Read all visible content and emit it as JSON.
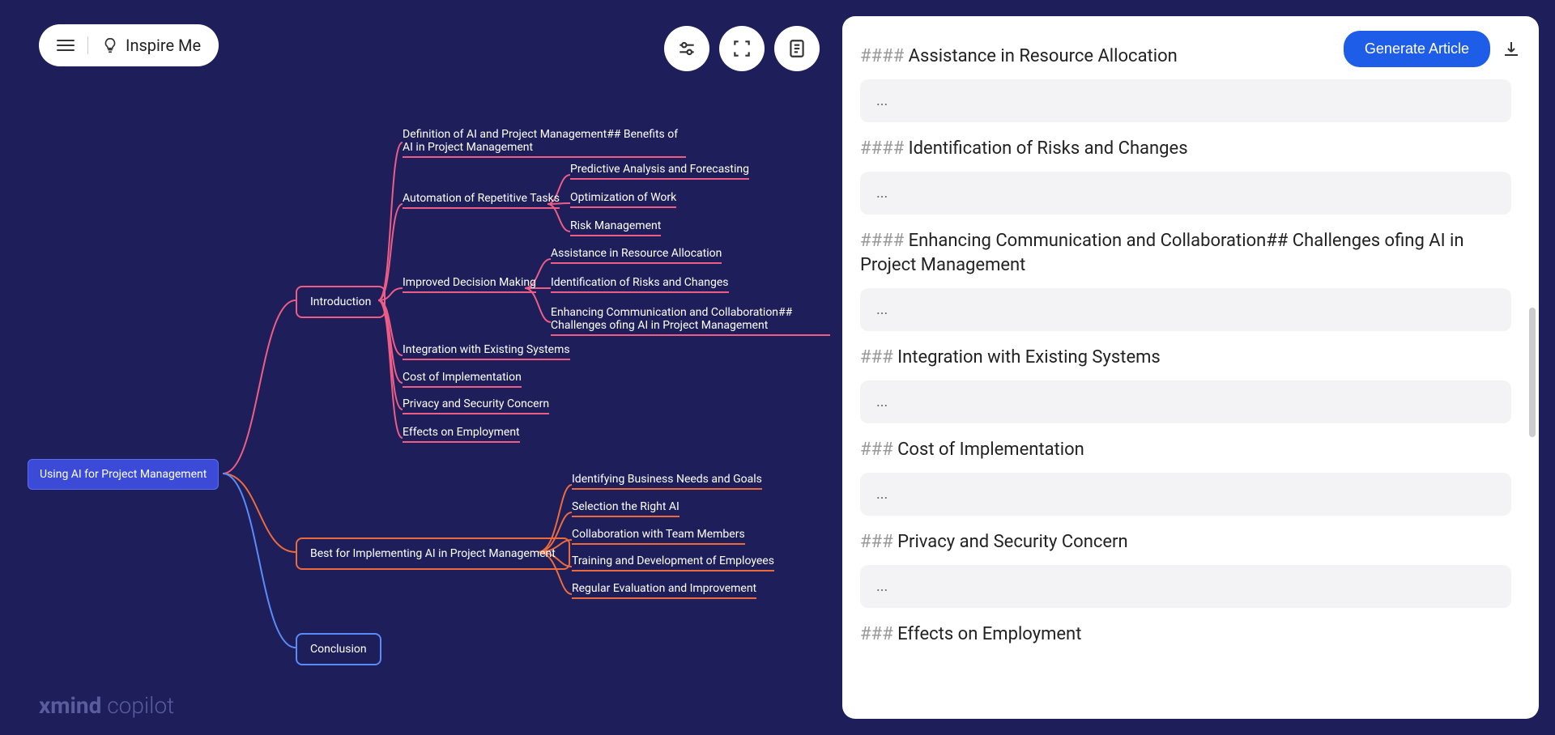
{
  "toolbar": {
    "inspire_label": "Inspire Me"
  },
  "logo": {
    "bold": "xmind",
    "light": " copilot"
  },
  "buttons": {
    "generate": "Generate Article"
  },
  "mindmap": {
    "root": "Using AI for Project Management",
    "branch1": "Introduction",
    "branch2": "Best for Implementing AI in Project Management",
    "branch3": "Conclusion",
    "intro_leaf1": "Definition of AI and Project Management## Benefits of AI in Project Management",
    "intro_leaf2": "Automation of Repetitive Tasks",
    "intro_leaf2a": "Predictive Analysis and Forecasting",
    "intro_leaf2b": "Optimization of Work",
    "intro_leaf2c": "Risk Management",
    "intro_leaf3": "Improved Decision Making",
    "intro_leaf3a": "Assistance in Resource Allocation",
    "intro_leaf3b": "Identification of Risks and Changes",
    "intro_leaf3c": "Enhancing Communication and Collaboration## Challenges ofing AI in Project Management",
    "intro_leaf4": "Integration with Existing Systems",
    "intro_leaf5": "Cost of Implementation",
    "intro_leaf6": "Privacy and Security Concern",
    "intro_leaf7": "Effects on Employment",
    "best_leaf1": "Identifying Business Needs and Goals",
    "best_leaf2": "Selection the Right AI",
    "best_leaf3": "Collaboration with Team Members",
    "best_leaf4": "Training and Development of Employees",
    "best_leaf5": "Regular Evaluation and Improvement"
  },
  "panel": {
    "sections": [
      {
        "hash": "#### ",
        "title": "Assistance in Resource Allocation",
        "content": "..."
      },
      {
        "hash": "#### ",
        "title": "Identification of Risks and Changes",
        "content": "..."
      },
      {
        "hash": "#### ",
        "title": "Enhancing Communication and Collaboration## Challenges ofing AI in Project Management",
        "content": "..."
      },
      {
        "hash": "### ",
        "title": "Integration with Existing Systems",
        "content": "..."
      },
      {
        "hash": "### ",
        "title": "Cost of Implementation",
        "content": "..."
      },
      {
        "hash": "### ",
        "title": "Privacy and Security Concern",
        "content": "..."
      },
      {
        "hash": "### ",
        "title": "Effects on Employment",
        "content": ""
      }
    ]
  }
}
